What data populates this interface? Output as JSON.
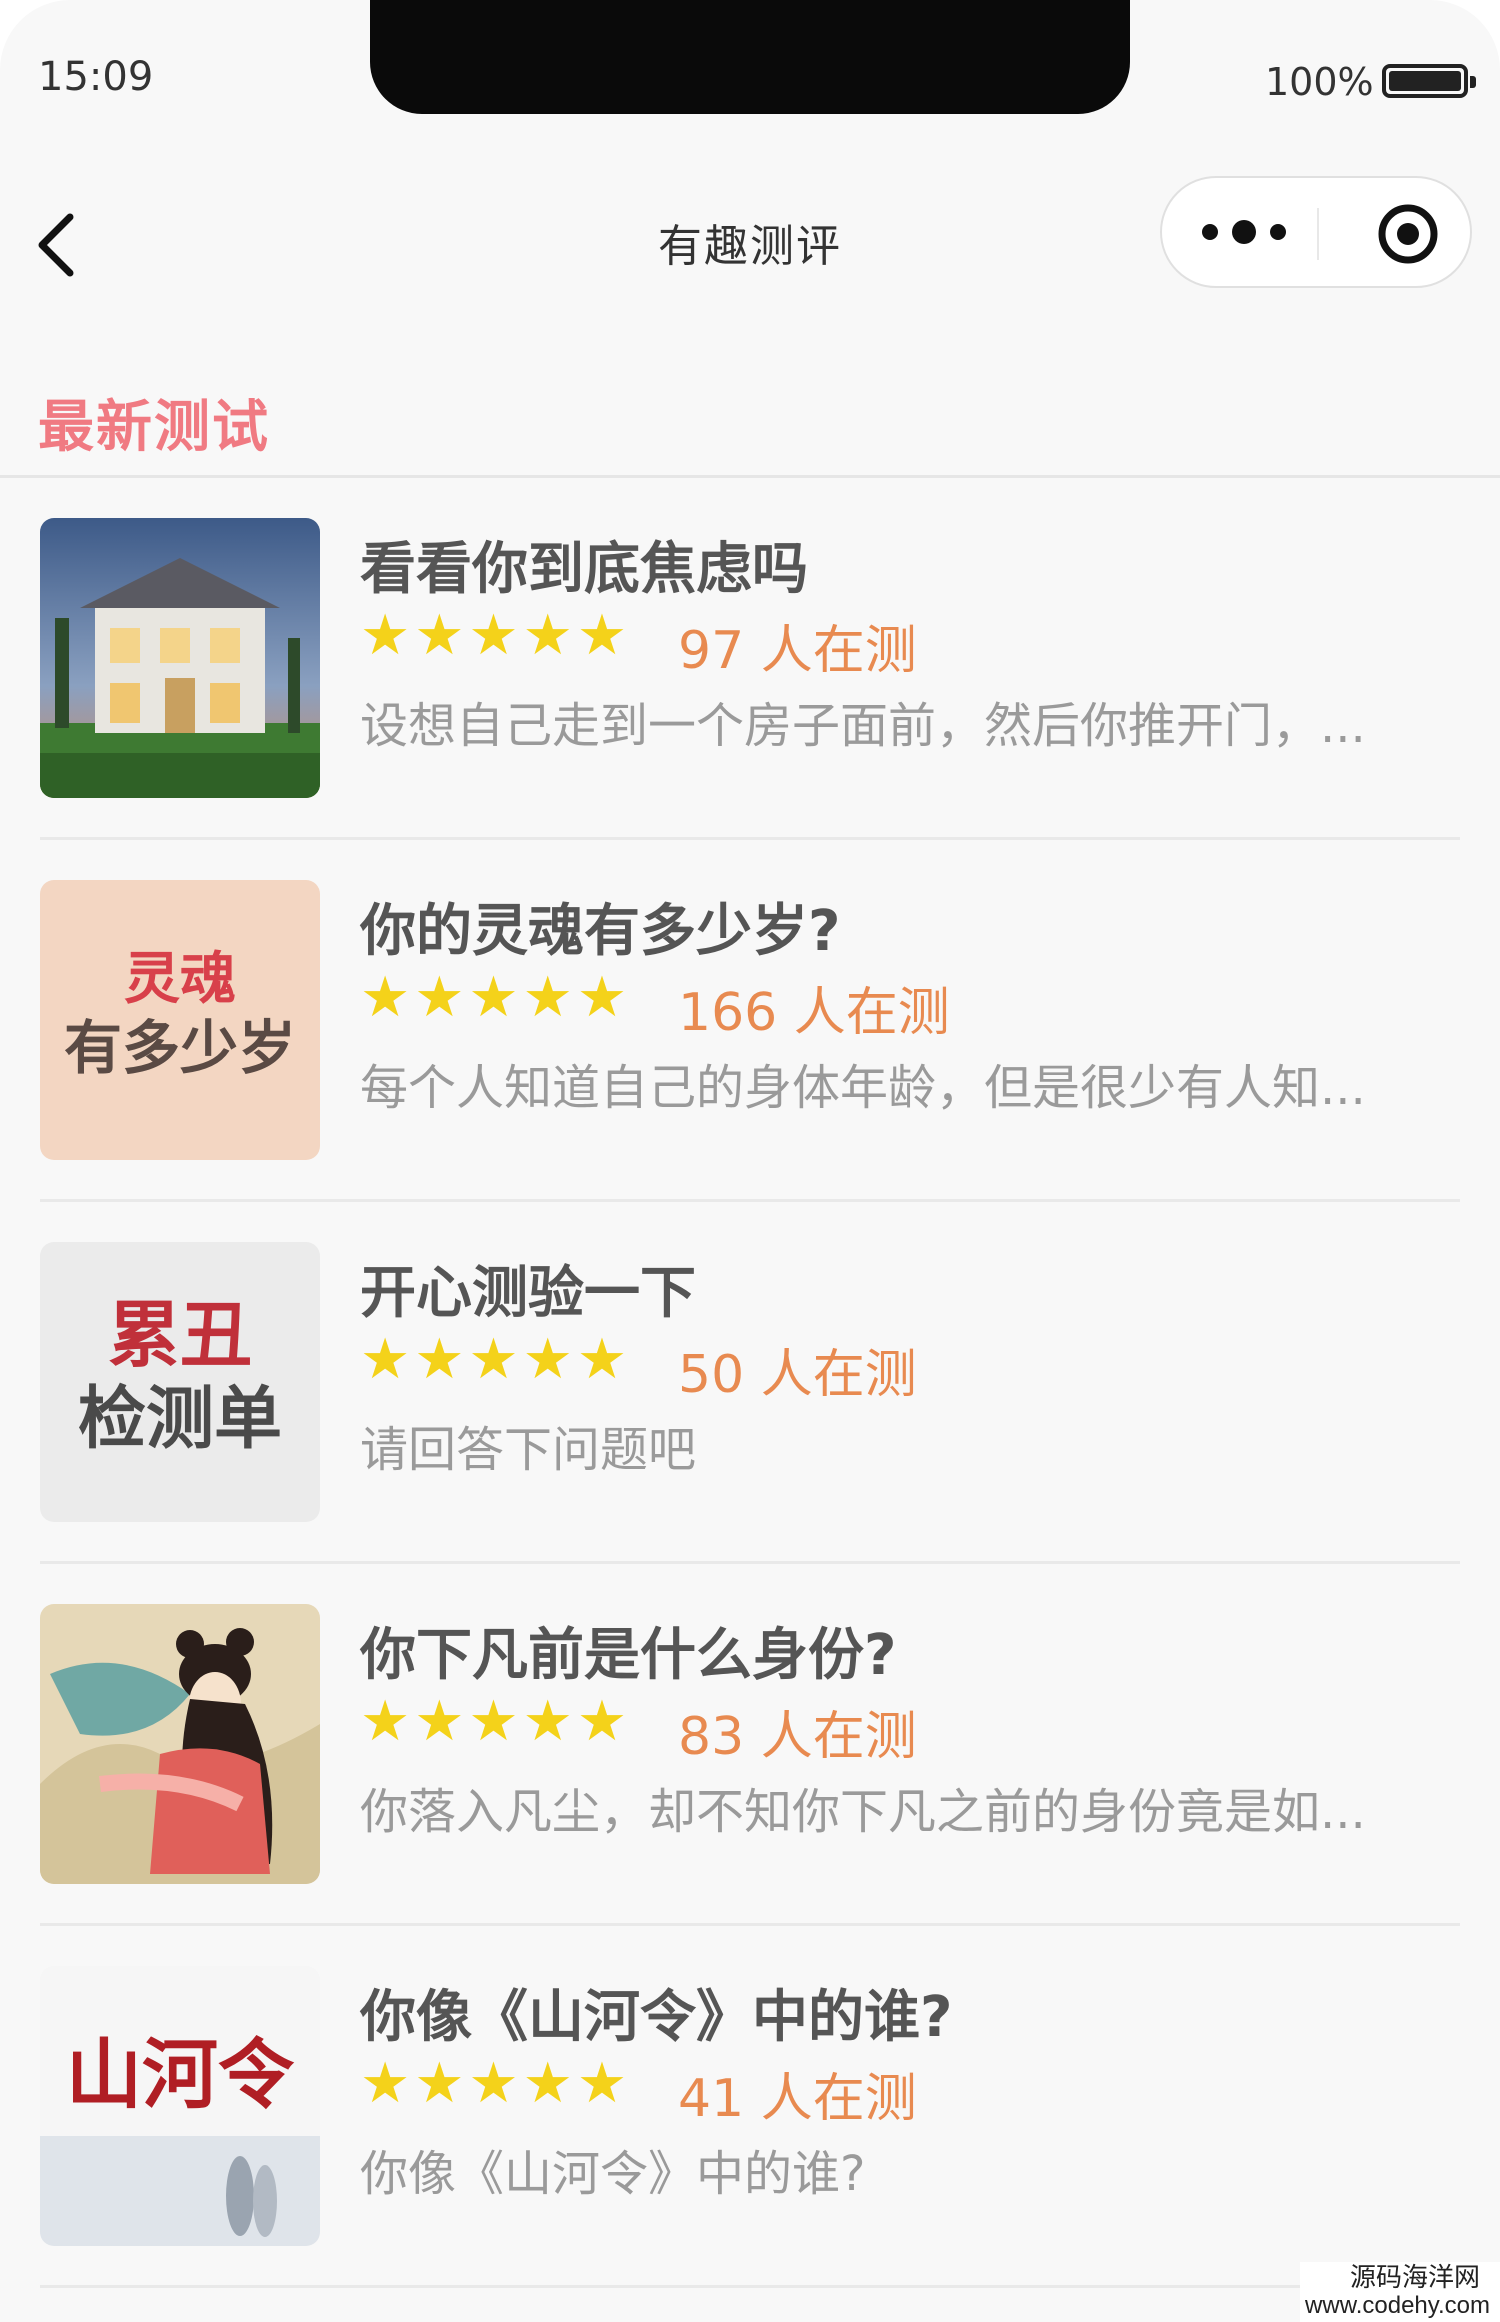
{
  "status_bar": {
    "time": "15:09",
    "battery": "100%"
  },
  "nav": {
    "title": "有趣测评"
  },
  "section": {
    "title": "最新测试"
  },
  "colors": {
    "accent": "#f07a82",
    "star": "#f4d21a",
    "count": "#e88a50"
  },
  "items": [
    {
      "title": "看看你到底焦虑吗",
      "stars": "★★★★★",
      "count": "97 人在测",
      "desc": "设想自己走到一个房子面前，然后你推开门，...",
      "thumb_icon": "house-photo"
    },
    {
      "title": "你的灵魂有多少岁?",
      "stars": "★★★★★",
      "count": "166 人在测",
      "desc": "每个人知道自己的身体年龄，但是很少有人知...",
      "thumb_icon": "soul-age-cover",
      "thumb_line1": "灵魂",
      "thumb_line2": "有多少岁"
    },
    {
      "title": "开心测验一下",
      "stars": "★★★★★",
      "count": "50 人在测",
      "desc": "请回答下问题吧",
      "thumb_icon": "checklist-cover",
      "thumb_line1": "累丑",
      "thumb_line2": "检测单"
    },
    {
      "title": "你下凡前是什么身份?",
      "stars": "★★★★★",
      "count": "83 人在测",
      "desc": "你落入凡尘，却不知你下凡之前的身份竟是如...",
      "thumb_icon": "fairy-illustration"
    },
    {
      "title": "你像《山河令》中的谁?",
      "stars": "★★★★★",
      "count": "41 人在测",
      "desc": "你像《山河令》中的谁?",
      "thumb_icon": "shanheling-poster",
      "thumb_line1": "山河令"
    }
  ],
  "watermark": {
    "line1": "源码海洋网",
    "line2": "www.codehy.com"
  }
}
